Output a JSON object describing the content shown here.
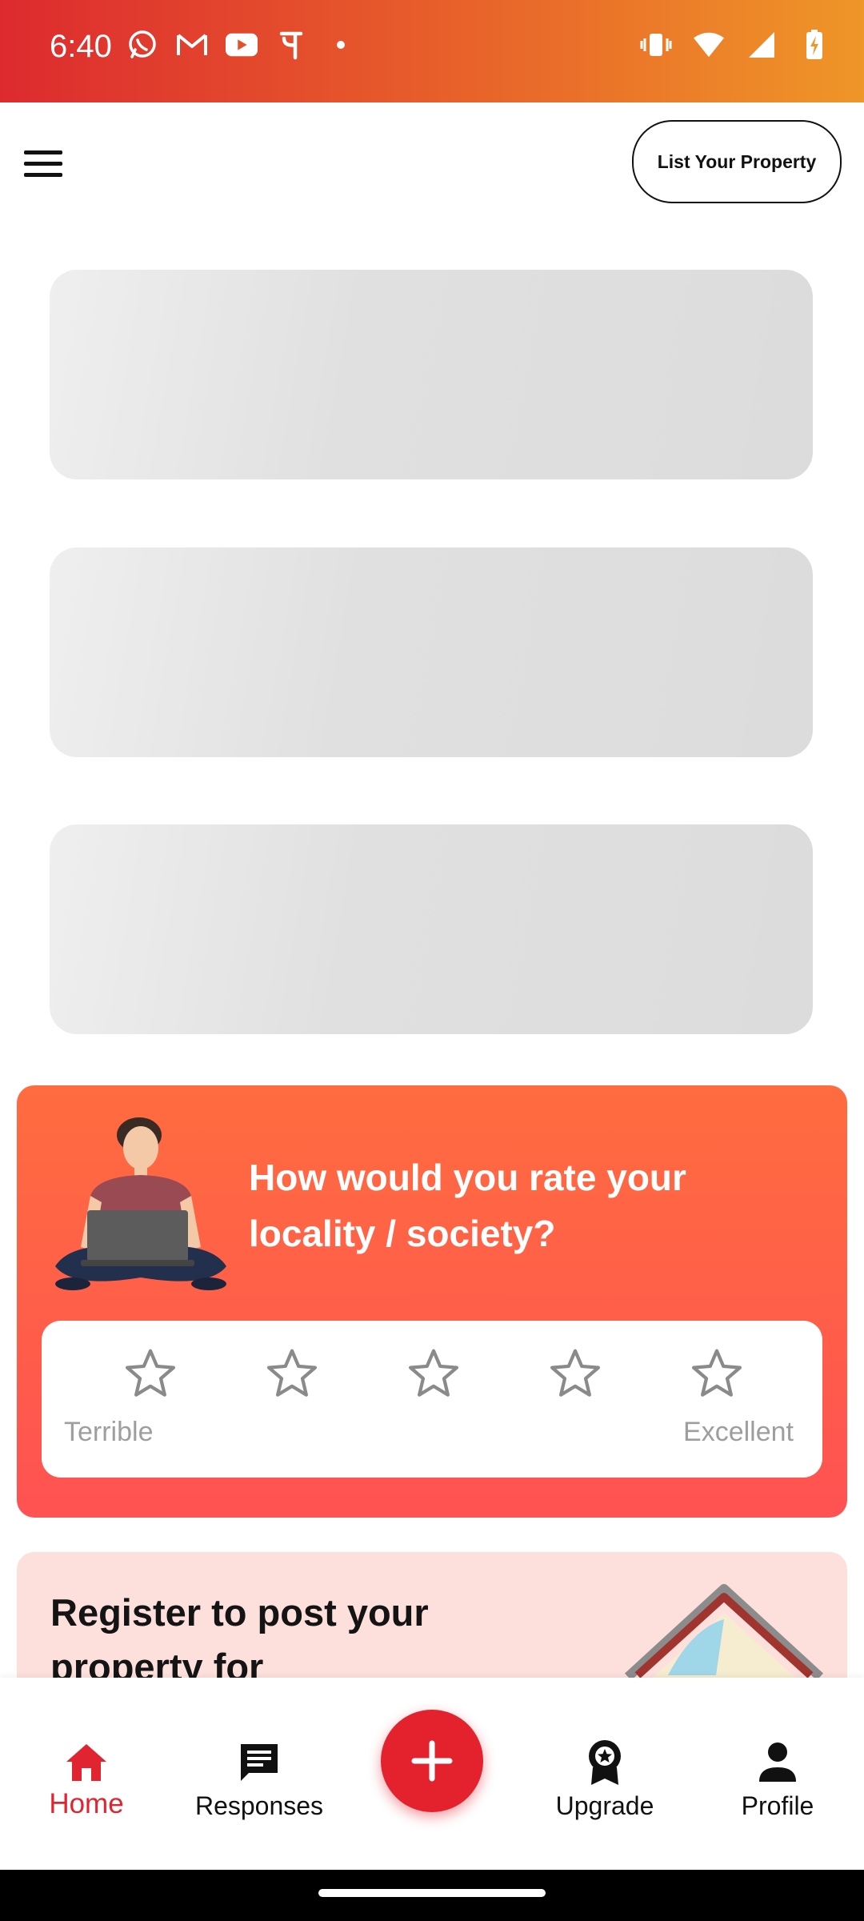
{
  "status_bar": {
    "time": "6:40",
    "left_icons": [
      "whatsapp-icon",
      "gmail-icon",
      "youtube-icon",
      "phonepe-icon",
      "dot-icon"
    ],
    "right_icons": [
      "vibrate-icon",
      "wifi-icon",
      "signal-icon",
      "battery-charging-icon"
    ]
  },
  "header": {
    "menu_icon": "hamburger-menu-icon",
    "list_property_label": "List Your Property"
  },
  "skeletons": {
    "count": 3
  },
  "rating_card": {
    "question": "How would you rate your locality / society?",
    "stars": [
      "star-1",
      "star-2",
      "star-3",
      "star-4",
      "star-5"
    ],
    "label_low": "Terrible",
    "label_high": "Excellent",
    "selected_rating": 0,
    "max_rating": 5
  },
  "register_card": {
    "title": "Register to post your property for"
  },
  "bottom_nav": {
    "items": [
      {
        "label": "Home",
        "icon": "home-icon",
        "active": true
      },
      {
        "label": "Responses",
        "icon": "chat-message-icon",
        "active": false
      },
      {
        "label": "",
        "icon": "plus-icon",
        "fab": true
      },
      {
        "label": "Upgrade",
        "icon": "award-badge-icon",
        "active": false
      },
      {
        "label": "Profile",
        "icon": "person-icon",
        "active": false
      }
    ]
  },
  "colors": {
    "brand_red": "#e3222d",
    "status_gradient_start": "#dd2a2f",
    "status_gradient_end": "#ef9628",
    "rating_card_top": "#ff6c3f",
    "rating_card_bottom": "#ff5252",
    "register_card_bg": "#fde0dc",
    "skeleton": "#e0e0e0"
  }
}
